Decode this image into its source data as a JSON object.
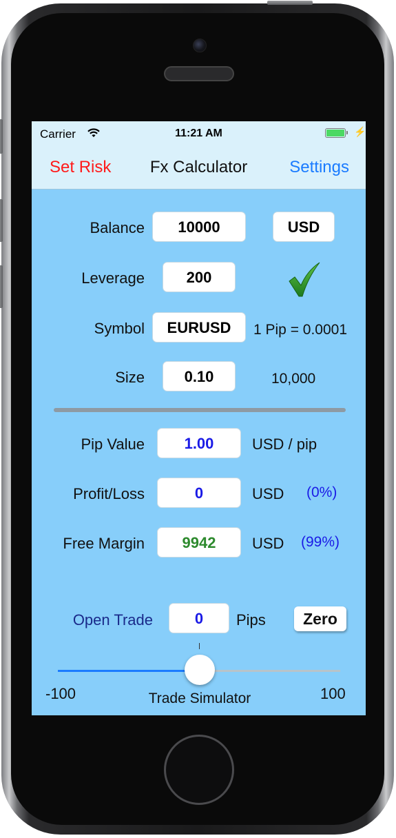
{
  "status_bar": {
    "carrier": "Carrier",
    "time": "11:21 AM",
    "wifi_icon": "wifi-icon",
    "battery_icon": "battery-icon",
    "charging_icon": "bolt-icon"
  },
  "nav": {
    "left_label": "Set Risk",
    "title": "Fx Calculator",
    "right_label": "Settings"
  },
  "form": {
    "balance": {
      "label": "Balance",
      "value": "10000",
      "currency": "USD"
    },
    "leverage": {
      "label": "Leverage",
      "value": "200",
      "status_icon": "checkmark-icon"
    },
    "symbol": {
      "label": "Symbol",
      "value": "EURUSD",
      "pip_info": "1 Pip = 0.0001"
    },
    "size": {
      "label": "Size",
      "value": "0.10",
      "units": "10,000"
    }
  },
  "results": {
    "pip_value": {
      "label": "Pip Value",
      "value": "1.00",
      "unit": "USD / pip"
    },
    "profit_loss": {
      "label": "Profit/Loss",
      "value": "0",
      "unit": "USD",
      "percent": "(0%)"
    },
    "free_margin": {
      "label": "Free Margin",
      "value": "9942",
      "unit": "USD",
      "percent": "(99%)"
    }
  },
  "trade": {
    "open_trade_label": "Open Trade",
    "pips_value": "0",
    "pips_label": "Pips",
    "zero_button": "Zero",
    "slider_min": "-100",
    "slider_max": "100",
    "slider_value": 0,
    "slider_caption": "Trade Simulator"
  },
  "colors": {
    "accent_red": "#ff1a1a",
    "accent_blue": "#1a7bff",
    "screen_bg": "#87cefa",
    "nav_bg": "#daf1fb",
    "value_blue": "#1a1ae6",
    "value_green": "#2d8a2d"
  }
}
